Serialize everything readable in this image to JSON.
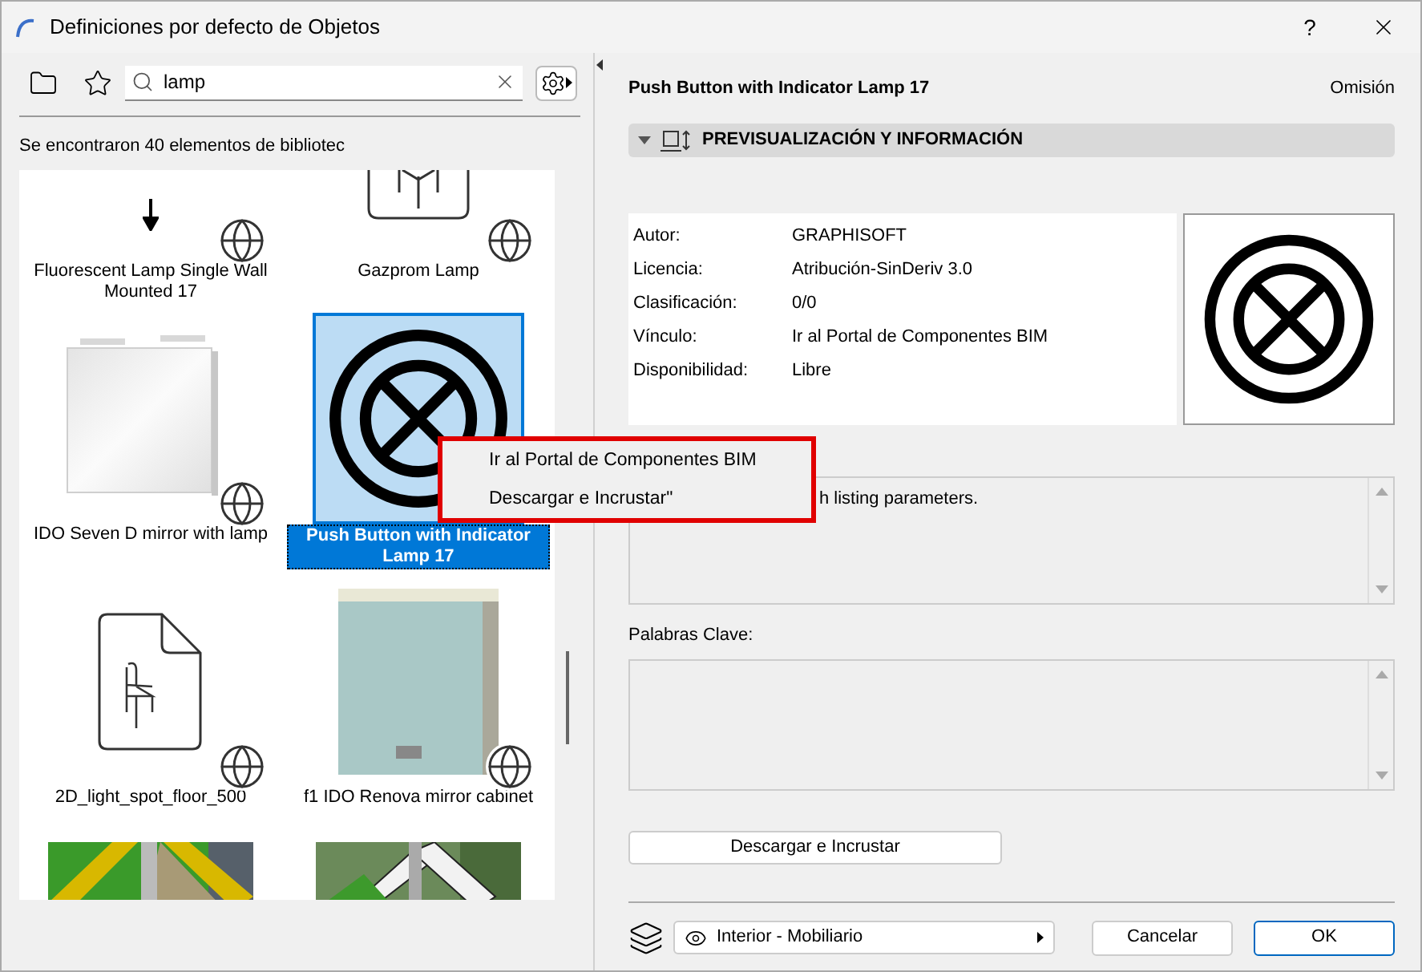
{
  "window": {
    "title": "Definiciones por defecto de Objetos",
    "help": "?"
  },
  "search": {
    "value": "lamp"
  },
  "result_count": "Se encontraron 40 elementos de bibliotec",
  "items": [
    {
      "label": "Fluorescent Lamp Single Wall Mounted 17",
      "kind": "arrow",
      "selected": false,
      "online": true
    },
    {
      "label": "Gazprom Lamp",
      "kind": "lamp",
      "selected": false,
      "online": true
    },
    {
      "label": "IDO Seven D mirror with lamp",
      "kind": "mirror",
      "selected": false,
      "online": true
    },
    {
      "label": "Push Button with Indicator Lamp 17",
      "kind": "symbol",
      "selected": true,
      "online": false
    },
    {
      "label": "2D_light_spot_floor_500",
      "kind": "file",
      "selected": false,
      "online": true
    },
    {
      "label": "f1 IDO Renova mirror cabinet",
      "kind": "cabinet",
      "selected": false,
      "online": true
    },
    {
      "kind": "crossing",
      "selected": false,
      "online": false
    },
    {
      "kind": "sign",
      "selected": false,
      "online": false
    }
  ],
  "context_menu": [
    "Ir al Portal de Componentes BIM",
    "Descargar e Incrustar\""
  ],
  "detail": {
    "title": "Push Button with Indicator Lamp 17",
    "mode": "Omisión",
    "section": {
      "title": "PREVISUALIZACIÓN Y INFORMACIÓN",
      "expanded": true
    },
    "info": [
      {
        "label": "Autor:",
        "value": "GRAPHISOFT"
      },
      {
        "label": "Licencia:",
        "value": "Atribución-SinDeriv 3.0"
      },
      {
        "label": "Clasificación:",
        "value": "0/0"
      },
      {
        "label": "Vínculo:",
        "value": "Ir al Portal de Componentes BIM"
      },
      {
        "label": "Disponibilidad:",
        "value": "Libre"
      }
    ],
    "description": "h listing parameters.",
    "keywords_label": "Palabras Clave:",
    "download_button": "Descargar e Incrustar"
  },
  "footer": {
    "layer": "Interior - Mobiliario",
    "buttons": [
      "Cancelar",
      "OK"
    ]
  }
}
